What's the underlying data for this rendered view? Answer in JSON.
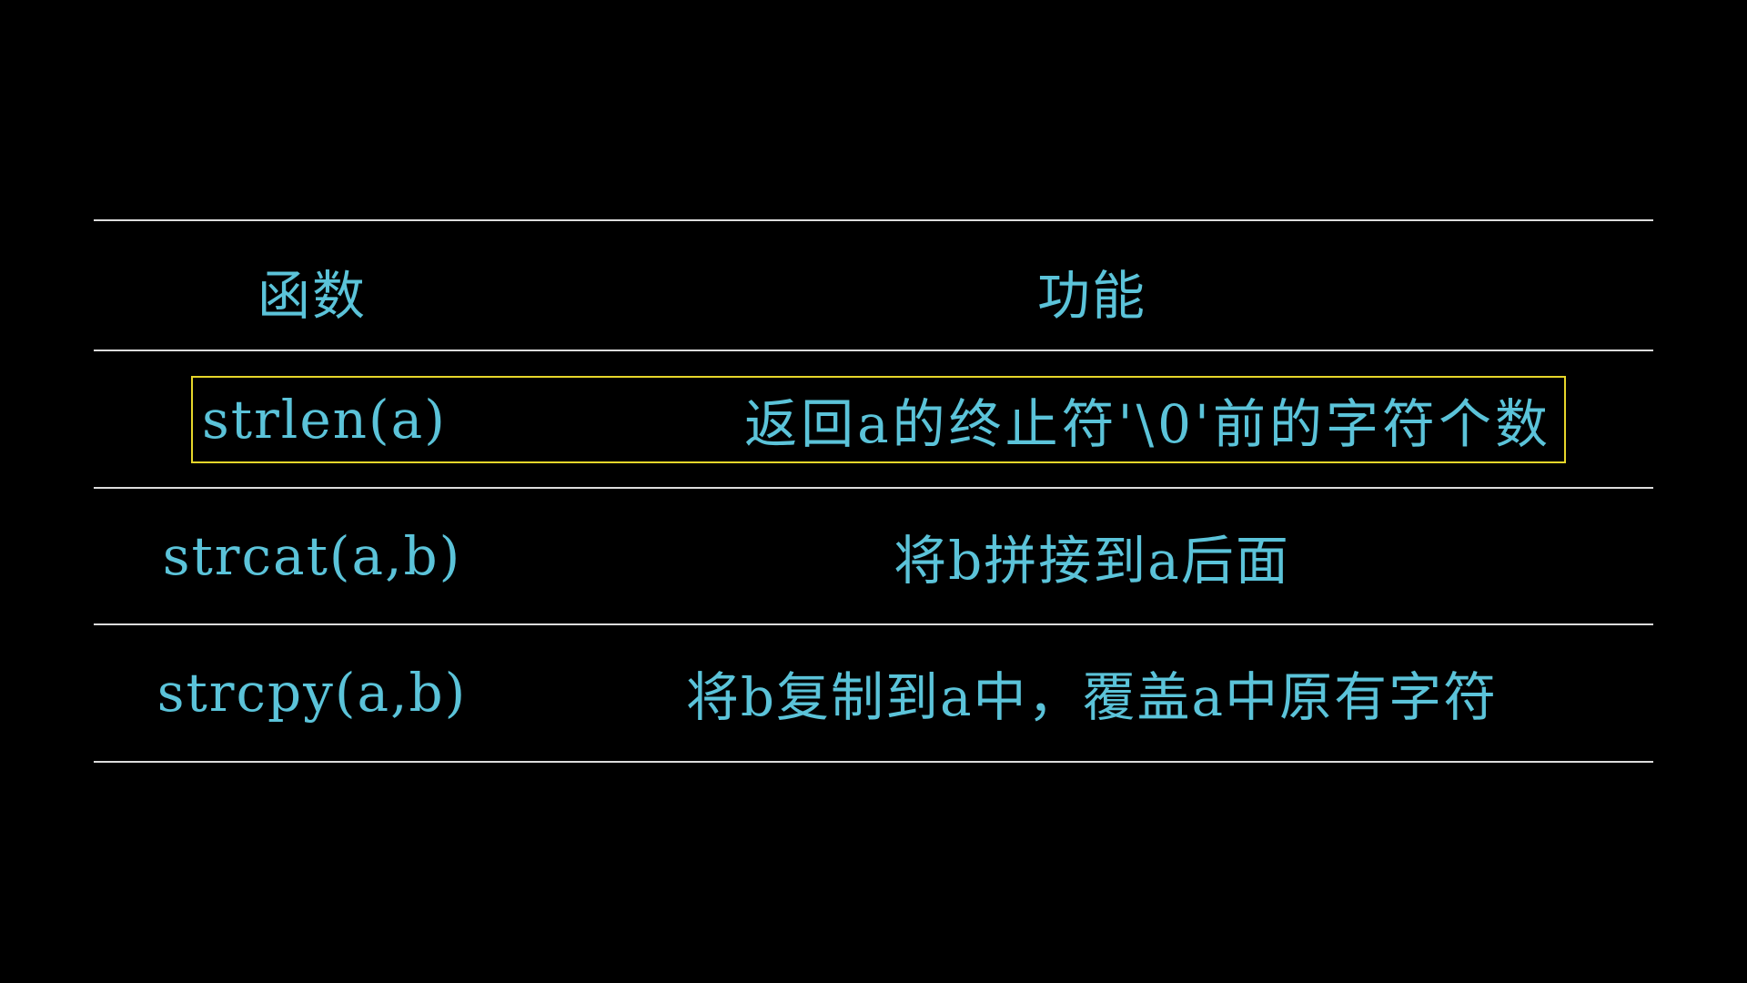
{
  "slide": {
    "background": "#000000",
    "text_color": "#5bc3d9",
    "rule_color": "#dcdcdc",
    "highlight_color": "#e6d62a"
  },
  "table": {
    "headers": {
      "function": "函数",
      "description": "功能"
    },
    "rows": [
      {
        "function": "strlen(a)",
        "description": "返回a的终止符'\\0'前的字符个数",
        "highlighted": true
      },
      {
        "function": "strcat(a,b)",
        "description": "将b拼接到a后面",
        "highlighted": false
      },
      {
        "function": "strcpy(a,b)",
        "description": "将b复制到a中，覆盖a中原有字符",
        "highlighted": false
      }
    ]
  }
}
